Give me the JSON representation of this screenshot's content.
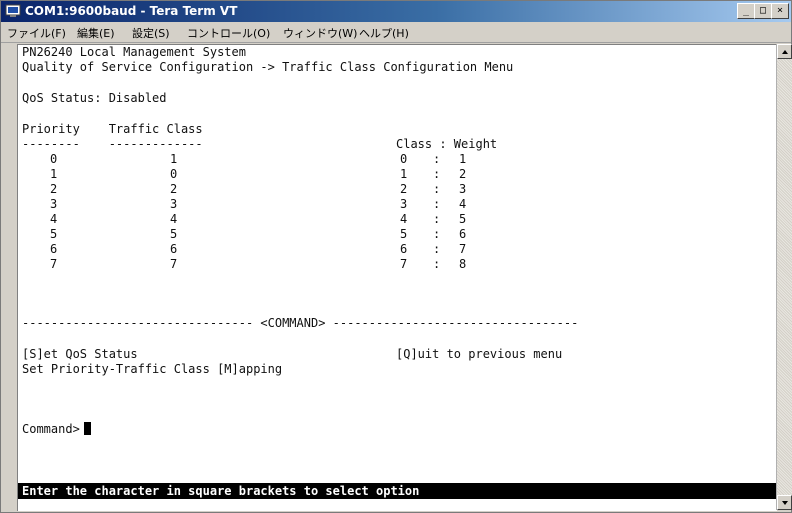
{
  "window": {
    "title": "COM1:9600baud - Tera Term VT",
    "buttons": {
      "minimize": "_",
      "maximize": "□",
      "close": "×"
    }
  },
  "menu": [
    {
      "label": "ファイル(F)"
    },
    {
      "label": "編集(E)"
    },
    {
      "label": "設定(S)"
    },
    {
      "label": "コントロール(O)"
    },
    {
      "label": "ウィンドウ(W)"
    },
    {
      "label": "ヘルプ(H)"
    }
  ],
  "terminal": {
    "system_name": "PN26240 Local Management System",
    "breadcrumb": "Quality of Service Configuration -> Traffic Class Configuration Menu",
    "qos_status": "QoS Status: Disabled",
    "mapping_header": "Priority    Traffic Class",
    "mapping_underline": "--------    -------------",
    "weight_header": "Class : Weight",
    "mapping_rows": [
      {
        "priority": "0",
        "traffic_class": "1",
        "class": "0",
        "weight": "1"
      },
      {
        "priority": "1",
        "traffic_class": "0",
        "class": "1",
        "weight": "2"
      },
      {
        "priority": "2",
        "traffic_class": "2",
        "class": "2",
        "weight": "3"
      },
      {
        "priority": "3",
        "traffic_class": "3",
        "class": "3",
        "weight": "4"
      },
      {
        "priority": "4",
        "traffic_class": "4",
        "class": "4",
        "weight": "5"
      },
      {
        "priority": "5",
        "traffic_class": "5",
        "class": "5",
        "weight": "6"
      },
      {
        "priority": "6",
        "traffic_class": "6",
        "class": "6",
        "weight": "7"
      },
      {
        "priority": "7",
        "traffic_class": "7",
        "class": "7",
        "weight": "8"
      }
    ],
    "command_divider": "-------------------------------- <COMMAND> ----------------------------------",
    "commands": {
      "set_qos_status": "[S]et QoS Status",
      "quit": "[Q]uit to previous menu",
      "set_mapping": "Set Priority-Traffic Class [M]apping"
    },
    "prompt": "Command>",
    "status_hint": "Enter the character in square brackets to select option"
  }
}
